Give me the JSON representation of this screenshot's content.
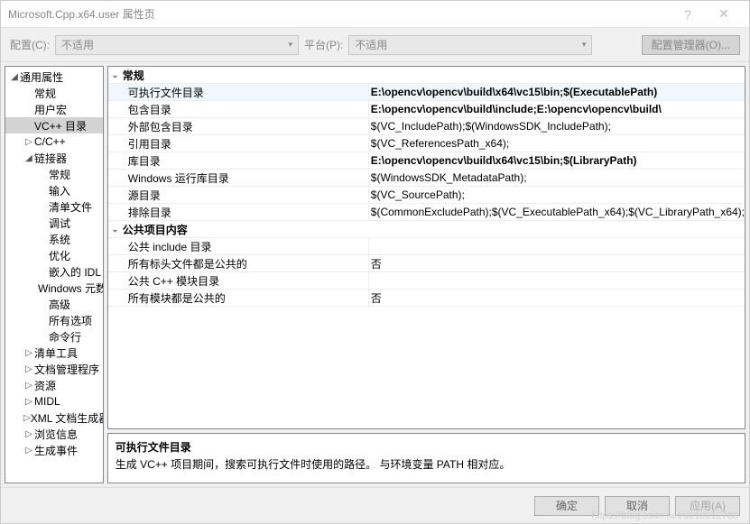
{
  "window": {
    "title": "Microsoft.Cpp.x64.user 属性页"
  },
  "toolbar": {
    "config_label": "配置(C):",
    "config_value": "不适用",
    "platform_label": "平台(P):",
    "platform_value": "不适用",
    "mgr_label": "配置管理器(O)..."
  },
  "tree": {
    "items": [
      {
        "label": "通用属性",
        "depth": 0,
        "tw": "◢"
      },
      {
        "label": "常规",
        "depth": 1,
        "tw": ""
      },
      {
        "label": "用户宏",
        "depth": 1,
        "tw": ""
      },
      {
        "label": "VC++ 目录",
        "depth": 1,
        "tw": "",
        "sel": true
      },
      {
        "label": "C/C++",
        "depth": 1,
        "tw": "▷"
      },
      {
        "label": "链接器",
        "depth": 1,
        "tw": "◢"
      },
      {
        "label": "常规",
        "depth": 2,
        "tw": ""
      },
      {
        "label": "输入",
        "depth": 2,
        "tw": ""
      },
      {
        "label": "清单文件",
        "depth": 2,
        "tw": ""
      },
      {
        "label": "调试",
        "depth": 2,
        "tw": ""
      },
      {
        "label": "系统",
        "depth": 2,
        "tw": ""
      },
      {
        "label": "优化",
        "depth": 2,
        "tw": ""
      },
      {
        "label": "嵌入的 IDL",
        "depth": 2,
        "tw": ""
      },
      {
        "label": "Windows 元数据",
        "depth": 2,
        "tw": ""
      },
      {
        "label": "高级",
        "depth": 2,
        "tw": ""
      },
      {
        "label": "所有选项",
        "depth": 2,
        "tw": ""
      },
      {
        "label": "命令行",
        "depth": 2,
        "tw": ""
      },
      {
        "label": "清单工具",
        "depth": 1,
        "tw": "▷"
      },
      {
        "label": "文档管理程序",
        "depth": 1,
        "tw": "▷"
      },
      {
        "label": "资源",
        "depth": 1,
        "tw": "▷"
      },
      {
        "label": "MIDL",
        "depth": 1,
        "tw": "▷"
      },
      {
        "label": "XML 文档生成器",
        "depth": 1,
        "tw": "▷"
      },
      {
        "label": "浏览信息",
        "depth": 1,
        "tw": "▷"
      },
      {
        "label": "生成事件",
        "depth": 1,
        "tw": "▷"
      }
    ]
  },
  "groups": [
    {
      "name": "常规",
      "rows": [
        {
          "label": "可执行文件目录",
          "value": "E:\\opencv\\opencv\\build\\x64\\vc15\\bin;$(ExecutablePath)",
          "bold": true,
          "sel": true
        },
        {
          "label": "包含目录",
          "value": "E:\\opencv\\opencv\\build\\include;E:\\opencv\\opencv\\build\\",
          "bold": true
        },
        {
          "label": "外部包含目录",
          "value": "$(VC_IncludePath);$(WindowsSDK_IncludePath);"
        },
        {
          "label": "引用目录",
          "value": "$(VC_ReferencesPath_x64);"
        },
        {
          "label": "库目录",
          "value": "E:\\opencv\\opencv\\build\\x64\\vc15\\bin;$(LibraryPath)",
          "bold": true
        },
        {
          "label": "Windows 运行库目录",
          "value": "$(WindowsSDK_MetadataPath);"
        },
        {
          "label": "源目录",
          "value": "$(VC_SourcePath);"
        },
        {
          "label": "排除目录",
          "value": "$(CommonExcludePath);$(VC_ExecutablePath_x64);$(VC_LibraryPath_x64);"
        }
      ]
    },
    {
      "name": "公共项目内容",
      "rows": [
        {
          "label": "公共 include 目录",
          "value": ""
        },
        {
          "label": "所有标头文件都是公共的",
          "value": "否"
        },
        {
          "label": "公共 C++ 模块目录",
          "value": ""
        },
        {
          "label": "所有模块都是公共的",
          "value": "否"
        }
      ]
    }
  ],
  "desc": {
    "title": "可执行文件目录",
    "text": "生成 VC++ 项目期间，搜索可执行文件时使用的路径。   与环境变量 PATH 相对应。"
  },
  "footer": {
    "ok": "确定",
    "cancel": "取消",
    "apply": "应用(A)"
  },
  "watermark": "https://blog.csdn.net/u010012788"
}
